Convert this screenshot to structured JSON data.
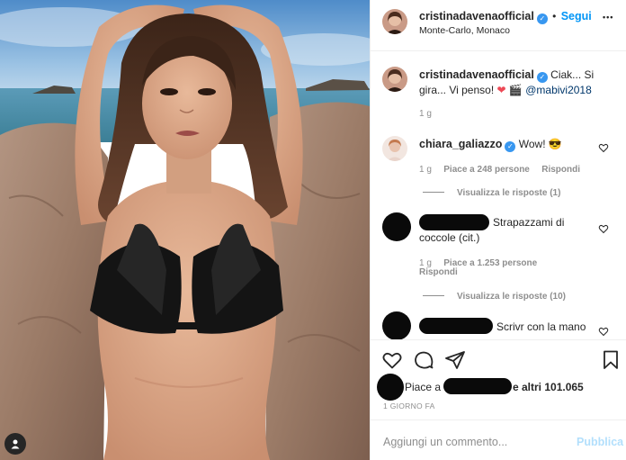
{
  "header": {
    "username": "cristinadavenaofficial",
    "separator": "•",
    "follow_label": "Segui",
    "location": "Monte-Carlo, Monaco",
    "more_label": "•••"
  },
  "caption": {
    "username": "cristinadavenaofficial",
    "text_a": "Ciak... Si",
    "text_b": "gira... Vi penso!",
    "emoji_heart": "❤",
    "emoji_clapper": "🎬",
    "mention": "@mabivi2018",
    "time": "1 g"
  },
  "comments": [
    {
      "username": "chiara_galiazzo",
      "text": "Wow!",
      "emoji": "😎",
      "time": "1 g",
      "likes": "Piace a 248 persone",
      "reply": "Rispondi",
      "view_replies": "Visualizza le risposte (1)"
    },
    {
      "text_a": "Strapazzami di",
      "text_b": "coccole (cit.)",
      "time": "1 g",
      "likes": "Piace a 1.253 persone",
      "reply": "Rispondi",
      "view_replies": "Visualizza le risposte (10)"
    },
    {
      "text": "Scrivr con la mano"
    }
  ],
  "likes_line": {
    "prefix": "Piace a",
    "suffix": "e altri 101.065"
  },
  "timestamp": "1 GIORNO FA",
  "comment_box": {
    "placeholder": "Aggiungi un commento...",
    "publish_label": "Pubblica"
  },
  "colors": {
    "accent": "#0095f6",
    "verified": "#3897f0",
    "heart": "#ed4956",
    "publish_disabled": "#b2dffc",
    "redaction": "#0a0a0a"
  },
  "icons": [
    "like-icon",
    "comment-icon",
    "share-icon",
    "save-icon",
    "person-tag-icon",
    "verified-icon",
    "heart-small-icon"
  ]
}
